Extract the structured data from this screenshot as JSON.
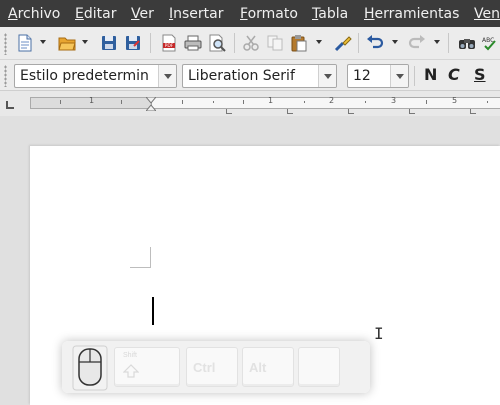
{
  "menubar": {
    "items": [
      {
        "mnemonic": "A",
        "rest": "rchivo"
      },
      {
        "mnemonic": "E",
        "rest": "ditar"
      },
      {
        "mnemonic": "V",
        "rest": "er"
      },
      {
        "mnemonic": "I",
        "rest": "nsertar"
      },
      {
        "mnemonic": "F",
        "rest": "ormato"
      },
      {
        "mnemonic": "T",
        "rest": "abla"
      },
      {
        "mnemonic": "H",
        "rest": "erramientas"
      },
      {
        "mnemonic": "Ven",
        "rest": ""
      }
    ]
  },
  "toolbar2": {
    "paragraph_style": "Estilo predetermin",
    "font_name": "Liberation Serif",
    "font_size": "12",
    "bold": "N",
    "italic": "C",
    "underline": "S"
  },
  "ruler": {
    "numbers": [
      "1",
      "1",
      "2",
      "3",
      "4",
      "5"
    ]
  },
  "keys": {
    "shift_label": "Shift",
    "ctrl_label": "Ctrl",
    "alt_label": "Alt"
  },
  "icons": {
    "new": "new-document-icon",
    "open": "open-folder-icon",
    "save": "save-icon",
    "save_as": "save-as-icon",
    "pdf": "export-pdf-icon",
    "print": "print-icon",
    "preview": "print-preview-icon",
    "cut": "cut-icon",
    "copy": "copy-icon",
    "paste": "paste-icon",
    "clone": "clone-formatting-icon",
    "undo": "undo-icon",
    "redo": "redo-icon",
    "find": "find-icon",
    "spell": "spellcheck-icon"
  },
  "colors": {
    "menubar_bg": "#3b3b3b",
    "toolbar_bg": "#ececec",
    "page_bg": "#ffffff"
  }
}
